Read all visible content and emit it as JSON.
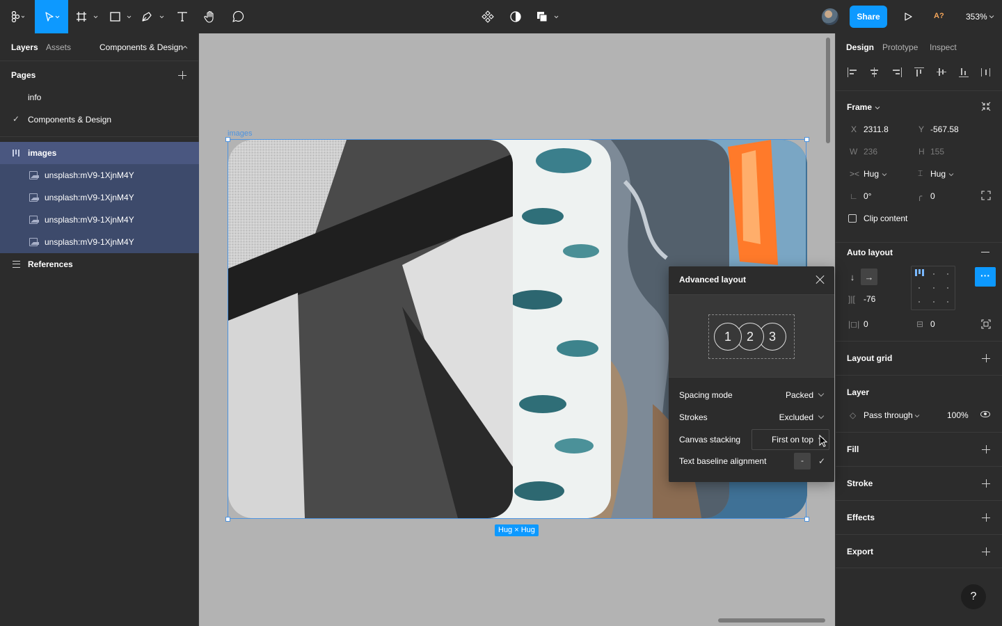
{
  "toolbar": {
    "share_label": "Share",
    "user_badge": "A?",
    "zoom": "353%"
  },
  "left_panel": {
    "tabs": [
      "Layers",
      "Assets"
    ],
    "page_selector": "Components & Design",
    "pages_title": "Pages",
    "pages": [
      "info",
      "Components & Design"
    ],
    "layers": {
      "frame": "images",
      "children": [
        "unsplash:mV9-1XjnM4Y",
        "unsplash:mV9-1XjnM4Y",
        "unsplash:mV9-1XjnM4Y",
        "unsplash:mV9-1XjnM4Y"
      ],
      "references": "References"
    }
  },
  "canvas": {
    "frame_label": "images",
    "hug_badge": "Hug × Hug"
  },
  "advanced_layout": {
    "title": "Advanced layout",
    "preview_numbers": [
      "1",
      "2",
      "3"
    ],
    "rows": {
      "spacing_mode": {
        "label": "Spacing mode",
        "value": "Packed"
      },
      "strokes": {
        "label": "Strokes",
        "value": "Excluded"
      },
      "canvas_stacking": {
        "label": "Canvas stacking",
        "value": "First on top"
      },
      "text_baseline": {
        "label": "Text baseline alignment",
        "value": "-"
      }
    }
  },
  "right_panel": {
    "tabs": [
      "Design",
      "Prototype",
      "Inspect"
    ],
    "frame": {
      "title": "Frame",
      "x_label": "X",
      "x": "2311.8",
      "y_label": "Y",
      "y": "-567.58",
      "w_label": "W",
      "w": "236",
      "h_label": "H",
      "h": "155",
      "w_mode": "Hug",
      "h_mode": "Hug",
      "rotation": "0°",
      "radius": "0",
      "clip_content": "Clip content"
    },
    "auto_layout": {
      "title": "Auto layout",
      "spacing": "-76",
      "padding_h": "0",
      "padding_v": "0"
    },
    "layout_grid": "Layout grid",
    "layer": {
      "title": "Layer",
      "blend": "Pass through",
      "opacity": "100%"
    },
    "fill": "Fill",
    "stroke": "Stroke",
    "effects": "Effects",
    "export": "Export"
  }
}
